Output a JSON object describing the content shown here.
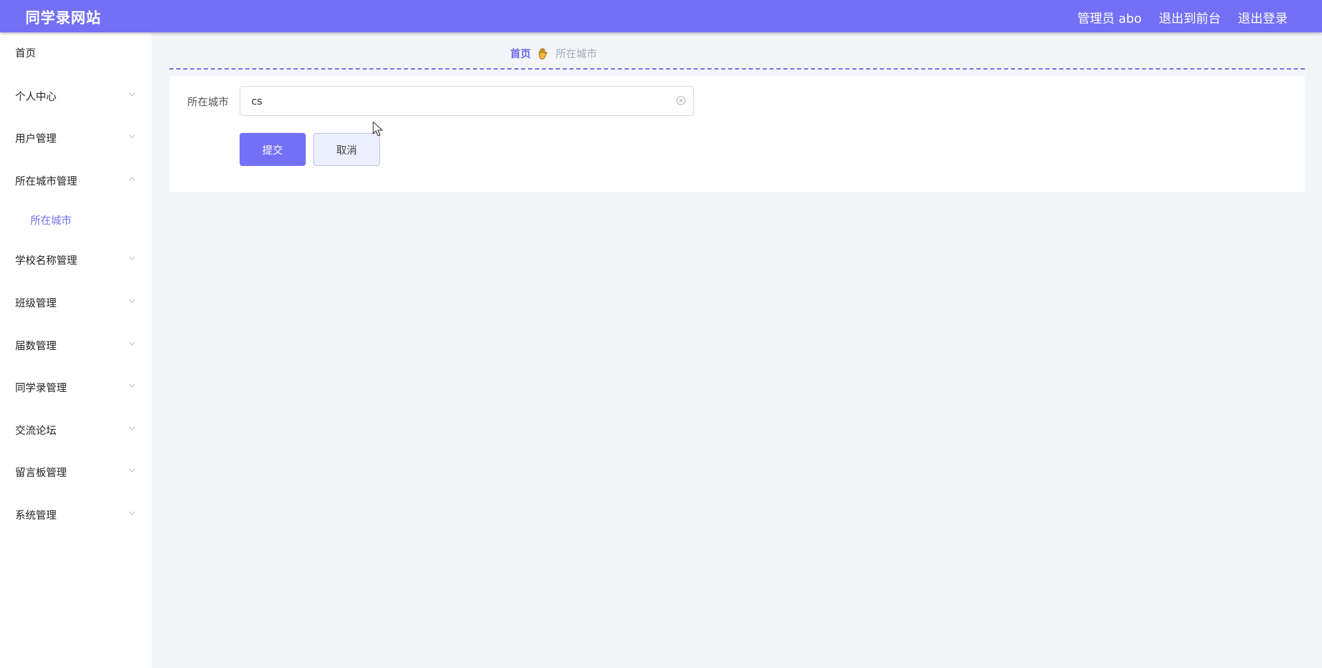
{
  "header": {
    "title": "同学录网站",
    "admin": "管理员 abo",
    "front": "退出到前台",
    "logout": "退出登录"
  },
  "sidebar": {
    "items": [
      {
        "label": "首页"
      },
      {
        "label": "个人中心"
      },
      {
        "label": "用户管理"
      },
      {
        "label": "所在城市管理"
      },
      {
        "label": "学校名称管理"
      },
      {
        "label": "班级管理"
      },
      {
        "label": "届数管理"
      },
      {
        "label": "同学录管理"
      },
      {
        "label": "交流论坛"
      },
      {
        "label": "留言板管理"
      },
      {
        "label": "系统管理"
      }
    ],
    "active_sub": "所在城市"
  },
  "breadcrumb": {
    "home": "首页",
    "current": "所在城市"
  },
  "form": {
    "label": "所在城市",
    "value": "cs",
    "submit": "提交",
    "cancel": "取消"
  },
  "colors": {
    "primary": "#7370f5",
    "background": "#f4f5f9",
    "cancel_bg": "#eaf0fd"
  }
}
